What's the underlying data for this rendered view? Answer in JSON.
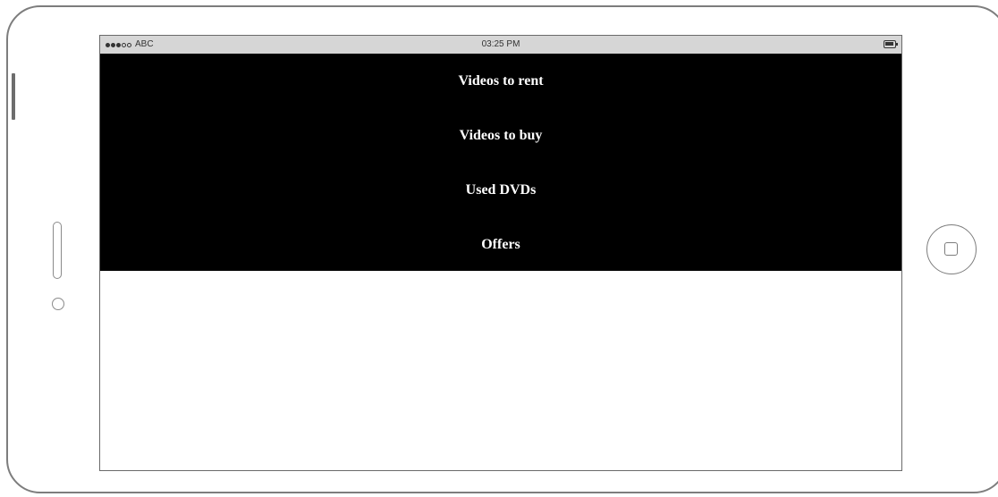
{
  "status_bar": {
    "signal": [
      "filled",
      "filled",
      "filled",
      "empty",
      "empty"
    ],
    "carrier": "ABC",
    "time": "03:25 PM",
    "battery_icon": "battery-icon"
  },
  "menu": {
    "items": [
      {
        "label": "Videos to rent"
      },
      {
        "label": "Videos to buy"
      },
      {
        "label": "Used DVDs"
      },
      {
        "label": "Offers"
      }
    ]
  },
  "colors": {
    "menu_background": "#000000",
    "menu_text": "#ffffff",
    "status_bar_background": "#d6d6d6",
    "device_outline": "#7d7d7d"
  }
}
